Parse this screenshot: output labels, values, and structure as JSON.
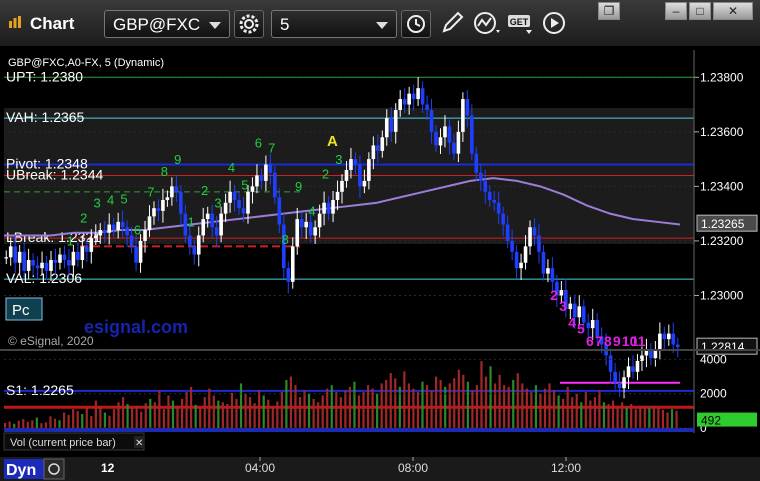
{
  "window": {
    "title": "Chart",
    "symbol": "GBP@FXC",
    "interval": "5",
    "get_button": "GET",
    "buttons": [
      "settings-icon",
      "clock-icon",
      "pencil-icon",
      "indicator-icon",
      "get-icon",
      "play-icon"
    ],
    "window_controls": [
      "restore-icon",
      "minimize-icon",
      "maximize-icon",
      "close-icon"
    ]
  },
  "chart_meta": {
    "series_label": "GBP@FXC,A0-FX, 5 (Dynamic)",
    "watermark": "esignal.com",
    "copyright": "© eSignal, 2020",
    "pattern_label": "A",
    "pc_label": "Pc",
    "volume_label": "Vol (current price bar)",
    "mode_label": "Dyn",
    "date_label": "12"
  },
  "colors": {
    "background": "#000000",
    "up_candle": "#ffffff",
    "down_candle": "#1f3fff",
    "moving_average": "#9b7ed8",
    "vah_line": "#49d3df",
    "pivot_line": "#1c2bd6",
    "breakout_line": "#d02020",
    "upper_line": "#2fa02f",
    "fib_magenta": "#e020e0",
    "fib_green": "#20d040",
    "volume_bar": "#a02828",
    "volume_bar_up": "#2a8a2a",
    "price_box": "#c0c0c0",
    "volume_box": "#2fcc2f"
  },
  "levels": [
    {
      "label": "UPT: 1.2380",
      "value": 1.238,
      "kind": "upper"
    },
    {
      "label": "VAH: 1.2365",
      "value": 1.2365,
      "kind": "vah"
    },
    {
      "label": "Pivot: 1.2348",
      "value": 1.2348,
      "kind": "pivot"
    },
    {
      "label": "UBreak: 1.2344",
      "value": 1.2344,
      "kind": "breakout"
    },
    {
      "label": "LBreak: 1.2321",
      "value": 1.2321,
      "kind": "breakout"
    },
    {
      "label": "VAL: 1.2306",
      "value": 1.2306,
      "kind": "vah"
    },
    {
      "label": "S1: 1.2265",
      "value": 1.2265,
      "kind": "pivot"
    }
  ],
  "price_boxes": [
    {
      "label": "1.23265",
      "value": 1.23265
    },
    {
      "label": "1.22814",
      "value": 1.22814
    }
  ],
  "volume_box": {
    "label": "492",
    "value": 492
  },
  "chart_data": {
    "type": "line",
    "title": "",
    "xlabel": "",
    "ylabel": "",
    "x_ticks": [
      "04:00",
      "08:00",
      "12:00"
    ],
    "y_ticks": [
      1.23,
      1.232,
      1.234,
      1.236,
      1.238
    ],
    "y_tick_labels": [
      "1.23000",
      "1.23200",
      "1.23400",
      "1.23600",
      "1.23800"
    ],
    "ylim": [
      1.228,
      1.239
    ],
    "volume_ticks": [
      0,
      2000,
      4000
    ],
    "volume_ylim": [
      0,
      4200
    ],
    "close_series": [
      1.2314,
      1.2318,
      1.2312,
      1.2316,
      1.2309,
      1.2313,
      1.2311,
      1.231,
      1.2312,
      1.2309,
      1.2313,
      1.2312,
      1.2315,
      1.2313,
      1.2311,
      1.2316,
      1.2313,
      1.2318,
      1.2316,
      1.2321,
      1.2322,
      1.2324,
      1.2323,
      1.2326,
      1.2324,
      1.2327,
      1.2325,
      1.2322,
      1.2318,
      1.2312,
      1.232,
      1.2324,
      1.2329,
      1.2332,
      1.2331,
      1.2335,
      1.2336,
      1.234,
      1.2338,
      1.233,
      1.2322,
      1.2318,
      1.2315,
      1.2322,
      1.2328,
      1.233,
      1.2325,
      1.2322,
      1.233,
      1.2334,
      1.2338,
      1.2335,
      1.2332,
      1.233,
      1.2338,
      1.234,
      1.2344,
      1.2342,
      1.2348,
      1.2345,
      1.2336,
      1.2326,
      1.231,
      1.2305,
      1.2318,
      1.2328,
      1.2325,
      1.2327,
      1.2322,
      1.2325,
      1.233,
      1.2334,
      1.233,
      1.2335,
      1.2338,
      1.2342,
      1.2346,
      1.235,
      1.2348,
      1.234,
      1.2342,
      1.235,
      1.2355,
      1.2353,
      1.2358,
      1.2365,
      1.236,
      1.2368,
      1.2372,
      1.237,
      1.2374,
      1.2372,
      1.2376,
      1.237,
      1.2368,
      1.236,
      1.2355,
      1.2358,
      1.2362,
      1.2356,
      1.2352,
      1.236,
      1.2372,
      1.2366,
      1.2352,
      1.2345,
      1.2342,
      1.2338,
      1.2335,
      1.2334,
      1.233,
      1.2326,
      1.232,
      1.2316,
      1.231,
      1.2312,
      1.2318,
      1.2325,
      1.2322,
      1.2316,
      1.2308,
      1.231,
      1.2305,
      1.23,
      1.2302,
      1.2295,
      1.2297,
      1.2292,
      1.2296,
      1.229,
      1.2288,
      1.2291,
      1.2285,
      1.2282,
      1.2278,
      1.2272,
      1.2268,
      1.2266,
      1.227,
      1.2274,
      1.2272,
      1.2276,
      1.2278,
      1.228,
      1.2277,
      1.228,
      1.2286,
      1.2284,
      1.2286,
      1.2282,
      1.2281
    ],
    "moving_average": [
      1.2322,
      1.2322,
      1.2322,
      1.2323,
      1.2323,
      1.2324,
      1.2324,
      1.2325,
      1.2326,
      1.2327,
      1.2328,
      1.2329,
      1.233,
      1.2331,
      1.2332,
      1.2333,
      1.2334,
      1.2336,
      1.2338,
      1.234,
      1.2342,
      1.2343,
      1.2342,
      1.234,
      1.2337,
      1.2333,
      1.233,
      1.2328,
      1.2327,
      1.2326
    ],
    "volume": [
      300,
      380,
      250,
      420,
      520,
      360,
      450,
      610,
      280,
      330,
      680,
      540,
      450,
      900,
      760,
      1100,
      980,
      820,
      1250,
      700,
      1600,
      1300,
      900,
      720,
      1100,
      1500,
      1800,
      1400,
      1200,
      1300,
      950,
      1450,
      1700,
      1500,
      2200,
      1100,
      1900,
      1600,
      1300,
      1700,
      2100,
      2400,
      1350,
      1150,
      1800,
      2300,
      1900,
      1600,
      1500,
      1400,
      2050,
      1700,
      2600,
      2000,
      1800,
      1450,
      2200,
      1900,
      1650,
      1200,
      1550,
      2100,
      2800,
      3000,
      2500,
      1800,
      2200,
      2000,
      1700,
      1500,
      1900,
      2300,
      2500,
      2100,
      1800,
      2200,
      2400,
      2700,
      1900,
      2100,
      2500,
      2300,
      2000,
      2600,
      2800,
      3200,
      2900,
      2400,
      3300,
      2600,
      2300,
      2100,
      2700,
      2500,
      2200,
      3000,
      2800,
      2400,
      2600,
      2900,
      3400,
      3100,
      2700,
      2200,
      2500,
      3900,
      3000,
      3600,
      2600,
      3100,
      2500,
      2400,
      2800,
      3200,
      2600,
      2300,
      2100,
      2500,
      2000,
      2300,
      2600,
      2200,
      1900,
      1700,
      2400,
      1800,
      2000,
      1500,
      2100,
      1600,
      1800,
      2200,
      1500,
      1400,
      1600,
      1300,
      1500,
      1200,
      1400,
      1100,
      1300,
      1250,
      1150,
      1300,
      1200,
      1050,
      900,
      1100,
      1000
    ],
    "fib_labels_green": [
      "1",
      "2",
      "3",
      "4",
      "5",
      "6",
      "7",
      "8",
      "9",
      "1",
      "2",
      "3",
      "4",
      "5",
      "6",
      "7",
      "8",
      "9",
      "4",
      "2",
      "3"
    ],
    "fib_labels_magenta": [
      "2",
      "3",
      "4",
      "5",
      "6",
      "7",
      "8",
      "9",
      "10",
      "11"
    ]
  }
}
